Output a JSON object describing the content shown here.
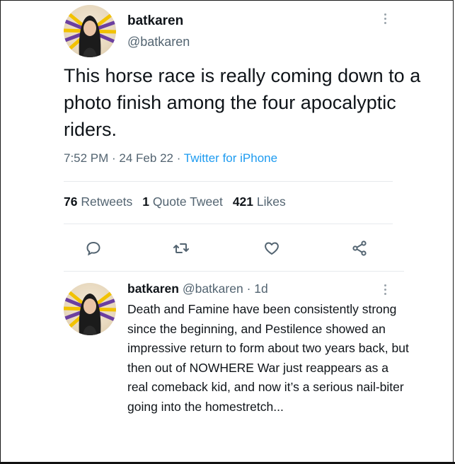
{
  "tweet": {
    "display_name": "batkaren",
    "handle": "@batkaren",
    "text": "This horse race is really coming down to a photo finish among the four apocalyptic riders.",
    "time": "7:52 PM · 24 Feb 22 · ",
    "source": "Twitter for iPhone",
    "stats": {
      "retweets_count": "76",
      "retweets_label": "Retweets",
      "quotes_count": "1",
      "quotes_label": "Quote Tweet",
      "likes_count": "421",
      "likes_label": "Likes"
    }
  },
  "reply": {
    "display_name": "batkaren",
    "handle": "@batkaren",
    "time": "· 1d",
    "text": "Death and Famine have been consistently strong since the beginning, and Pestilence showed an impressive return to form about two years back, but then out of NOWHERE War just reappears as a real comeback kid, and now it’s a serious nail-biter going into the homestretch..."
  },
  "icons": {
    "reply": "reply-icon",
    "retweet": "retweet-icon",
    "like": "heart-icon",
    "share": "share-icon",
    "more": "more-icon"
  },
  "colors": {
    "link": "#1d9bf0",
    "secondary_text": "#536471",
    "primary_text": "#0f1419"
  }
}
